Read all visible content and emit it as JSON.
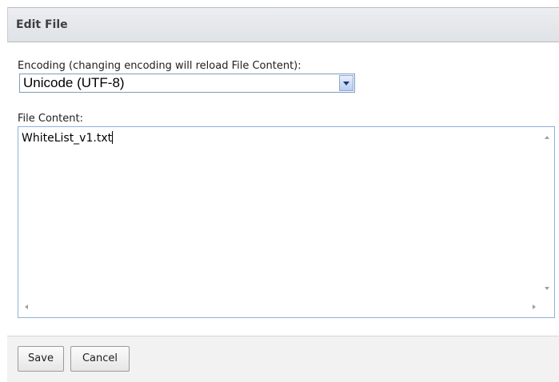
{
  "dialog": {
    "title": "Edit File"
  },
  "encoding": {
    "label": "Encoding (changing encoding will reload File Content):",
    "selected_value": "Unicode (UTF-8)"
  },
  "content": {
    "label": "File Content:",
    "text": "WhiteList_v1.txt"
  },
  "buttons": {
    "save_label": "Save",
    "cancel_label": "Cancel"
  },
  "icons": {
    "dropdown": "chevron-down-icon",
    "scroll_up": "scroll-up-icon",
    "scroll_down": "scroll-down-icon",
    "scroll_left": "scroll-left-icon",
    "scroll_right": "scroll-right-icon"
  },
  "colors": {
    "header_bg": "#e4e7eb",
    "field_border": "#7f9db9",
    "footer_bg": "#f2f2f2"
  }
}
